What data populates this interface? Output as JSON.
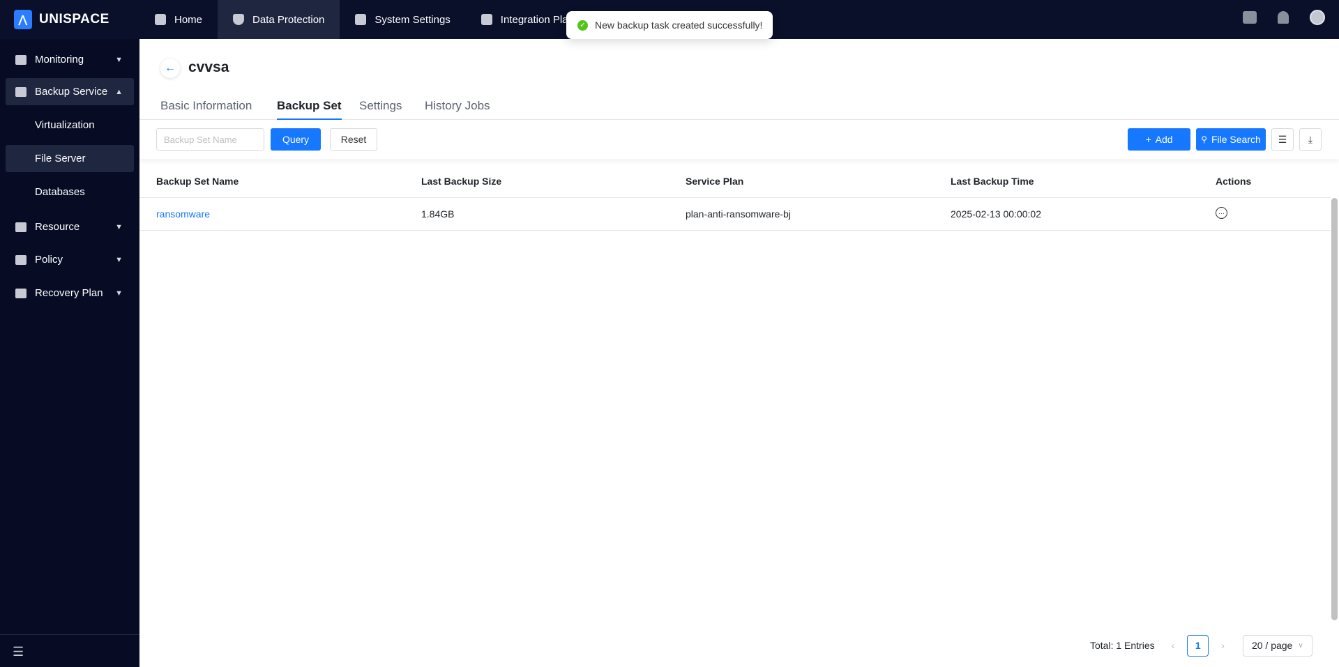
{
  "app": {
    "name": "UNISPACE"
  },
  "nav": [
    {
      "label": "Home"
    },
    {
      "label": "Data Protection"
    },
    {
      "label": "System Settings"
    },
    {
      "label": "Integration Platform"
    }
  ],
  "toast": {
    "message": "New backup task created successfully!"
  },
  "sidebar": {
    "items": [
      {
        "label": "Monitoring"
      },
      {
        "label": "Backup Service"
      },
      {
        "label": "Virtualization"
      },
      {
        "label": "File Server"
      },
      {
        "label": "Databases"
      },
      {
        "label": "Resource"
      },
      {
        "label": "Policy"
      },
      {
        "label": "Recovery Plan"
      }
    ]
  },
  "page": {
    "title": "cvvsa"
  },
  "tabs": [
    {
      "label": "Basic Information"
    },
    {
      "label": "Backup Set"
    },
    {
      "label": "Settings"
    },
    {
      "label": "History Jobs"
    }
  ],
  "toolbar": {
    "search_placeholder": "Backup Set Name",
    "query": "Query",
    "reset": "Reset",
    "add": "Add",
    "file_search": "File Search"
  },
  "table": {
    "columns": [
      "Backup Set Name",
      "Last Backup Size",
      "Service Plan",
      "Last Backup Time",
      "Actions"
    ],
    "rows": [
      [
        "ransomware",
        "1.84GB",
        "plan-anti-ransomware-bj",
        "2025-02-13 00:00:02"
      ]
    ]
  },
  "pagination": {
    "total": "Total: 1 Entries",
    "page": "1",
    "page_size": "20 / page"
  },
  "colors": {
    "accent": "#1677ff",
    "topbar": "#0a0f2a",
    "success": "#52c41a"
  }
}
